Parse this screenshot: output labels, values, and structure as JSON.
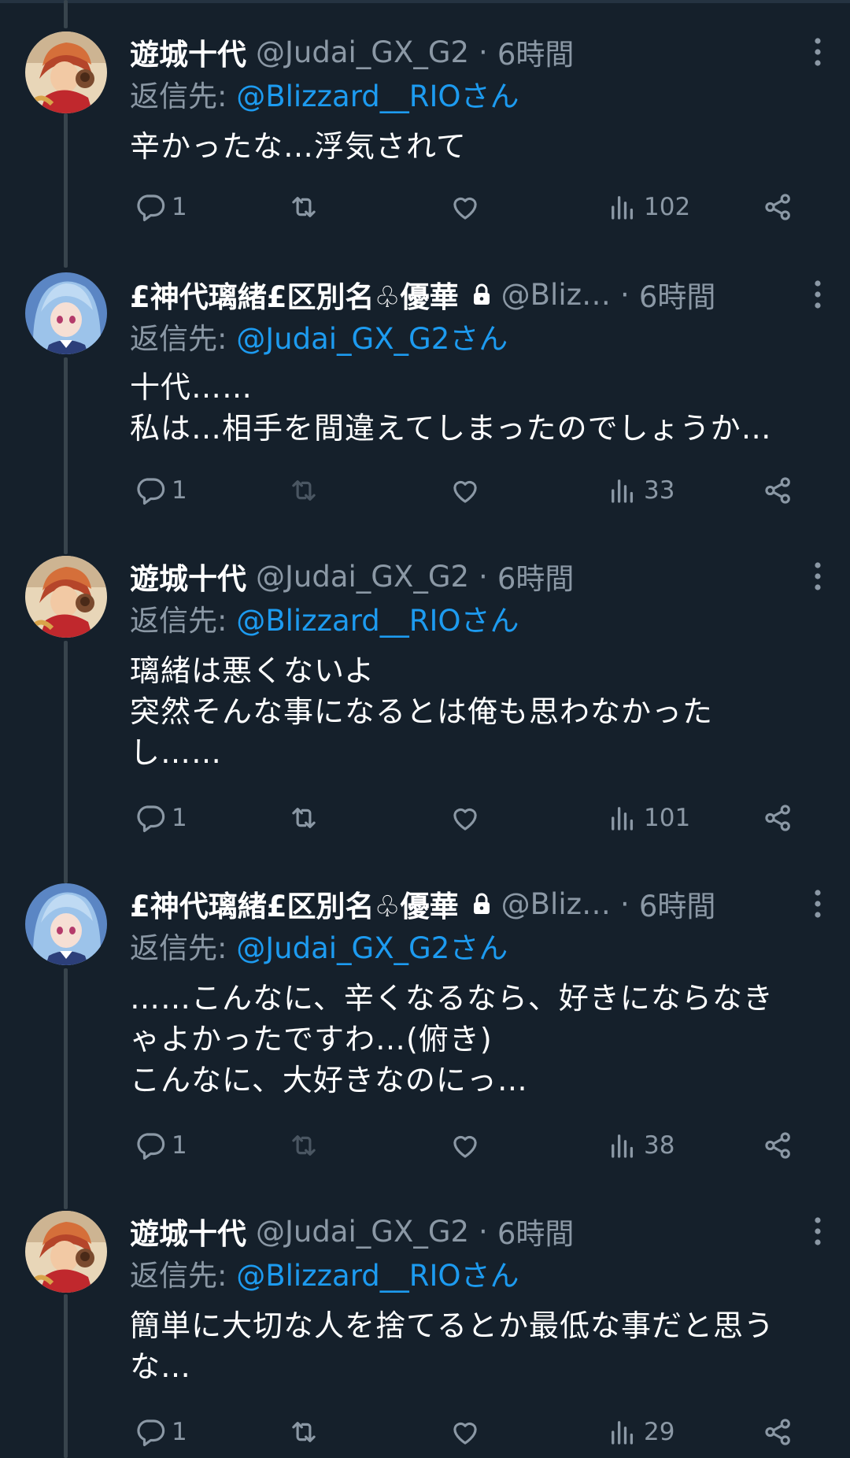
{
  "tweets": [
    {
      "author": "遊城十代",
      "handle": "@Judai_GX_G2",
      "separator": "·",
      "time": "6時間",
      "reply_prefix": "返信先: ",
      "reply_to": "@Blizzard__RIOさん",
      "text": "辛かったな…浮気されて",
      "replies": "1",
      "retweets": "",
      "likes": "",
      "views": "102",
      "locked": false,
      "avatar": "judai-avatar",
      "retweet_disabled": false
    },
    {
      "author": "£神代璃緒£区別名♧優華",
      "handle": "@Bliz…",
      "separator": "·",
      "time": "6時間",
      "reply_prefix": "返信先: ",
      "reply_to": "@Judai_GX_G2さん",
      "text": "十代……\n私は…相手を間違えてしまったのでしょうか…",
      "replies": "1",
      "retweets": "",
      "likes": "",
      "views": "33",
      "locked": true,
      "avatar": "rio-avatar",
      "retweet_disabled": true
    },
    {
      "author": "遊城十代",
      "handle": "@Judai_GX_G2",
      "separator": "·",
      "time": "6時間",
      "reply_prefix": "返信先: ",
      "reply_to": "@Blizzard__RIOさん",
      "text": "璃緒は悪くないよ\n突然そんな事になるとは俺も思わなかった\nし……",
      "replies": "1",
      "retweets": "",
      "likes": "",
      "views": "101",
      "locked": false,
      "avatar": "judai-avatar",
      "retweet_disabled": false
    },
    {
      "author": "£神代璃緒£区別名♧優華",
      "handle": "@Bliz…",
      "separator": "·",
      "time": "6時間",
      "reply_prefix": "返信先: ",
      "reply_to": "@Judai_GX_G2さん",
      "text": "……こんなに、辛くなるなら、好きにならなき\nゃよかったですわ…(俯き)\nこんなに、大好きなのにっ…",
      "replies": "1",
      "retweets": "",
      "likes": "",
      "views": "38",
      "locked": true,
      "avatar": "rio-avatar",
      "retweet_disabled": true
    },
    {
      "author": "遊城十代",
      "handle": "@Judai_GX_G2",
      "separator": "·",
      "time": "6時間",
      "reply_prefix": "返信先: ",
      "reply_to": "@Blizzard__RIOさん",
      "text": "簡単に大切な人を捨てるとか最低な事だと思う\nな…",
      "replies": "1",
      "retweets": "",
      "likes": "",
      "views": "29",
      "locked": false,
      "avatar": "judai-avatar",
      "retweet_disabled": false
    }
  ],
  "colors": {
    "background": "#15202b",
    "link": "#1d9bf0",
    "secondary_text": "#8b98a5",
    "thread_line": "#38444d"
  },
  "icons": {
    "reply": "reply-icon",
    "retweet": "retweet-icon",
    "like": "like-icon",
    "views": "views-icon",
    "share": "share-icon",
    "more": "more-icon",
    "lock": "lock-icon"
  }
}
